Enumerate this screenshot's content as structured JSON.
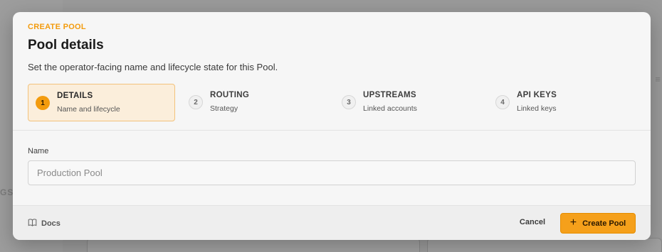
{
  "background": {
    "side_text": "GS",
    "right_glyph": "≡"
  },
  "modal": {
    "eyebrow": "CREATE POOL",
    "title": "Pool details",
    "subtitle": "Set the operator-facing name and lifecycle state for this Pool."
  },
  "steps": [
    {
      "num": "1",
      "title": "DETAILS",
      "sub": "Name and lifecycle",
      "active": true
    },
    {
      "num": "2",
      "title": "ROUTING",
      "sub": "Strategy",
      "active": false
    },
    {
      "num": "3",
      "title": "UPSTREAMS",
      "sub": "Linked accounts",
      "active": false
    },
    {
      "num": "4",
      "title": "API KEYS",
      "sub": "Linked keys",
      "active": false
    }
  ],
  "form": {
    "name_label": "Name",
    "name_placeholder": "Production Pool",
    "name_value": ""
  },
  "footer": {
    "docs_label": "Docs",
    "cancel_label": "Cancel",
    "create_label": "Create Pool",
    "create_icon": "plus-icon",
    "docs_icon": "book-icon"
  },
  "colors": {
    "accent": "#f39b0d",
    "active_step_bg": "#fbeedb",
    "active_step_border": "#f2c27c",
    "overlay": "#9a9a9a"
  }
}
